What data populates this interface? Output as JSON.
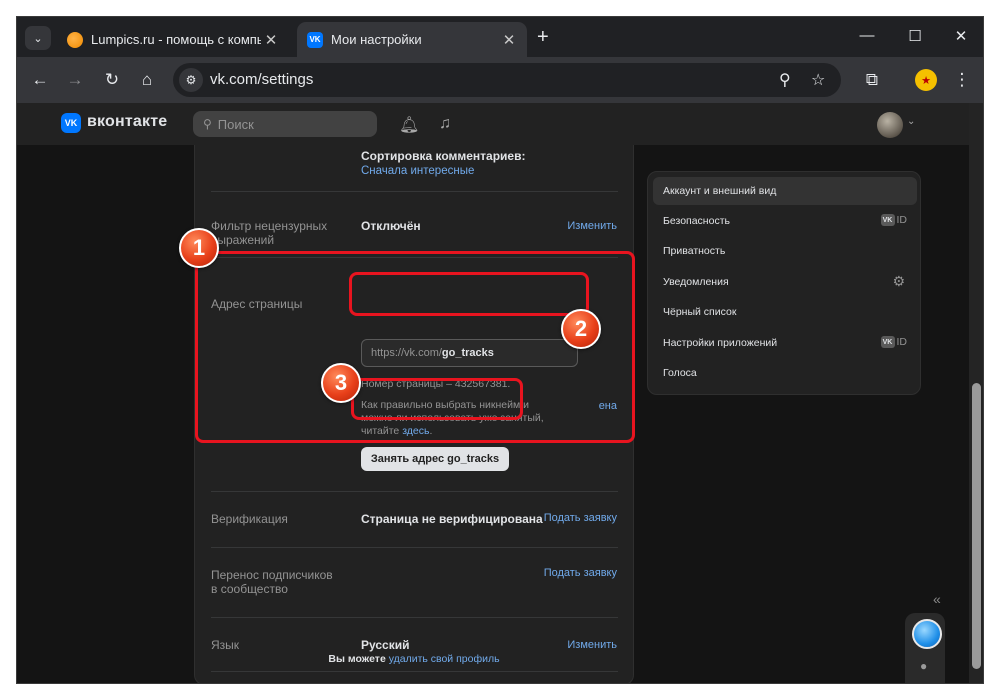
{
  "browser": {
    "tabs": [
      {
        "title": "Lumpics.ru - помощь с компь",
        "active": false
      },
      {
        "title": "Мои настройки",
        "active": true
      }
    ],
    "url": "vk.com/settings",
    "icons": {
      "menu": "chevron-down-icon",
      "back": "back-arrow-icon",
      "forward": "forward-arrow-icon",
      "reload": "reload-icon",
      "home": "home-icon",
      "zoom": "zoom-icon",
      "star": "bookmark-star-icon",
      "extensions": "puzzle-icon",
      "menu_dots": "kebab-menu-icon"
    }
  },
  "vk_header": {
    "logo_text": "вконтакте",
    "logo_mark": "VK",
    "search_placeholder": "Поиск"
  },
  "settings": {
    "comments_sort": {
      "label": "Сортировка комментариев:",
      "value": "Сначала интересные"
    },
    "filter": {
      "label": "Фильтр нецензурных выражений",
      "value": "Отключён",
      "action": "Изменить"
    },
    "address": {
      "label": "Адрес страницы",
      "prefix": "https://vk.com/",
      "nickname": "go_tracks",
      "page_number": "Номер страницы – 432567381.",
      "hint_line1": "Как правильно выбрать никнейм и",
      "hint_line2": "можно ли использовать уже занятый,",
      "hint_line3": "читайте ",
      "hint_link": "здесь",
      "hint_end": ".",
      "hidden_action": "ена",
      "button": "Занять адрес go_tracks"
    },
    "verification": {
      "label": "Верификация",
      "value": "Страница не верифицирована",
      "action": "Подать заявку"
    },
    "transfer": {
      "label_line1": "Перенос подписчиков",
      "label_line2": "в сообщество",
      "action": "Подать заявку"
    },
    "language": {
      "label": "Язык",
      "value": "Русский",
      "action": "Изменить"
    },
    "delete": {
      "prefix": "Вы можете ",
      "link": "удалить свой профиль"
    }
  },
  "menu": {
    "items": [
      {
        "label": "Аккаунт и внешний вид",
        "selected": true
      },
      {
        "label": "Безопасность",
        "badge": "ID"
      },
      {
        "label": "Приватность"
      },
      {
        "label": "Уведомления",
        "icon": "gear-icon"
      },
      {
        "label": "Чёрный список"
      },
      {
        "label": "Настройки приложений",
        "badge": "ID"
      },
      {
        "label": "Голоса"
      }
    ]
  },
  "annotations": {
    "badge1": "1",
    "badge2": "2",
    "badge3": "3",
    "color": "#e8141f"
  }
}
